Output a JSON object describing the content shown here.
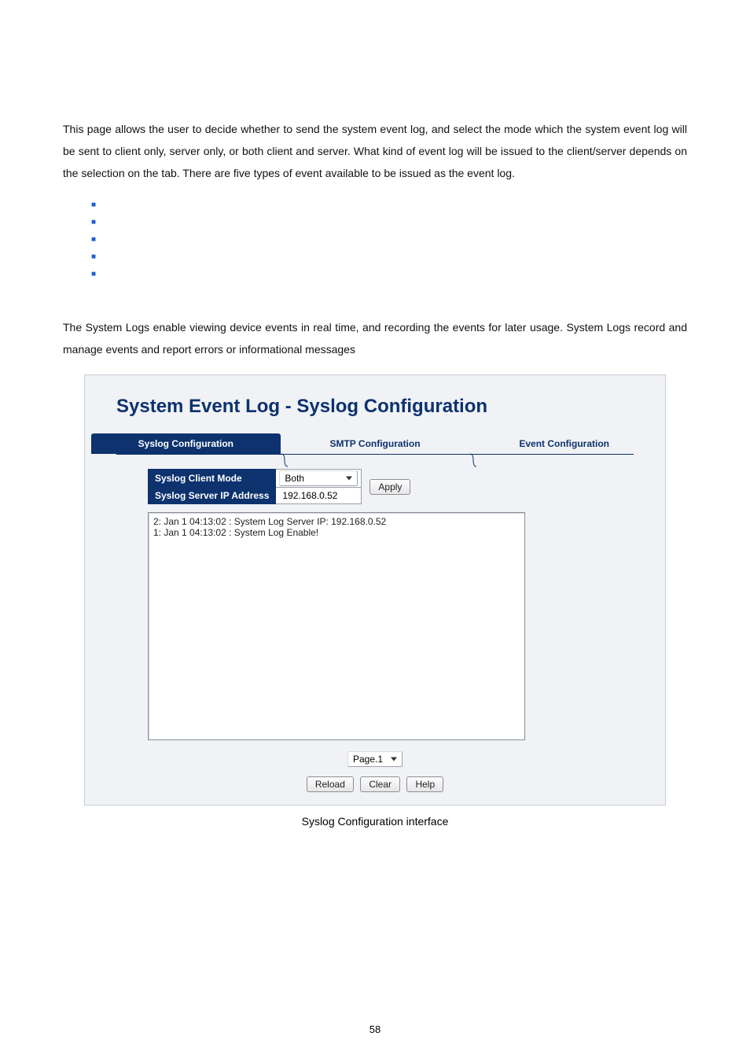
{
  "intro": {
    "p1a": "This page allows the user to decide whether to send the system event log, and select the mode which the system event log will be sent to client only, server only, or both client and server. What kind of event log will be issued to the client/server depends on the selection on the ",
    "p1b": " tab. There are five types of event available to be issued as the event log.",
    "p2": "The System Logs enable viewing device events in real time, and recording the events for later usage. System Logs record and manage events and report errors or informational messages"
  },
  "shot": {
    "title": "System Event Log - Syslog Configuration",
    "tabs": {
      "active": "Syslog Configuration",
      "smtp": "SMTP Configuration",
      "event": "Event Configuration"
    },
    "config": {
      "mode_label": "Syslog Client Mode",
      "mode_value": "Both",
      "ip_label": "Syslog Server IP Address",
      "ip_value": "192.168.0.52",
      "apply": "Apply"
    },
    "log_lines": [
      "2: Jan 1 04:13:02 : System Log Server IP: 192.168.0.52",
      "1: Jan 1 04:13:02 : System Log Enable!"
    ],
    "pager": "Page.1",
    "buttons": {
      "reload": "Reload",
      "clear": "Clear",
      "help": "Help"
    }
  },
  "caption": "Syslog Configuration interface",
  "page_number": "58"
}
